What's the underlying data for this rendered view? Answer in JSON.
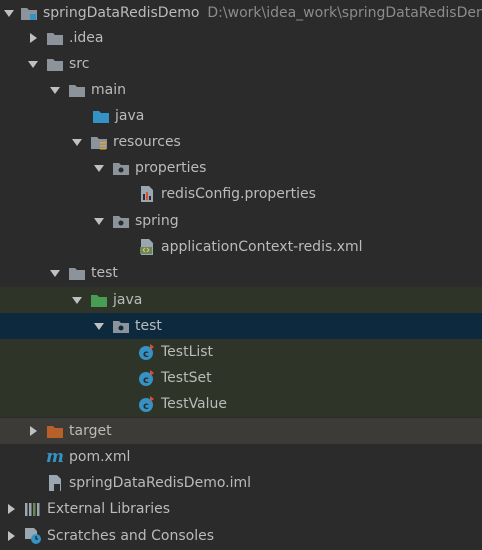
{
  "tree": {
    "root": {
      "label": "springDataRedisDemo",
      "path": "D:\\work\\idea_work\\springDataRedisDemo"
    },
    "idea": {
      "label": ".idea"
    },
    "src": {
      "label": "src"
    },
    "main": {
      "label": "main"
    },
    "main_java": {
      "label": "java"
    },
    "resources": {
      "label": "resources"
    },
    "properties": {
      "label": "properties"
    },
    "redis_config": {
      "label": "redisConfig.properties"
    },
    "spring": {
      "label": "spring"
    },
    "app_context": {
      "label": "applicationContext-redis.xml"
    },
    "test": {
      "label": "test"
    },
    "test_java": {
      "label": "java"
    },
    "test_pkg": {
      "label": "test"
    },
    "test_list": {
      "label": "TestList"
    },
    "test_set": {
      "label": "TestSet"
    },
    "test_value": {
      "label": "TestValue"
    },
    "target": {
      "label": "target"
    },
    "pom": {
      "label": "pom.xml"
    },
    "iml": {
      "label": "springDataRedisDemo.iml"
    },
    "external_libs": {
      "label": "External Libraries"
    },
    "scratches": {
      "label": "Scratches and Consoles"
    }
  },
  "colors": {
    "background": "#2b2b2b",
    "text": "#bbbbbb",
    "selected_row": "#0d293e",
    "test_source_row": "#2e3428",
    "excluded_row": "#3c3b37",
    "folder": "#8c939b",
    "source_folder": "#3592c4",
    "test_folder": "#499c54",
    "excluded_folder": "#b8602a",
    "class_icon": "#3592c4"
  }
}
